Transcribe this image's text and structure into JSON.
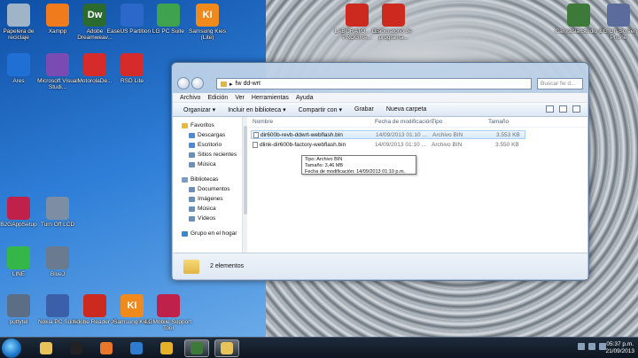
{
  "desktop_icons": [
    {
      "label": "Papelera de reciclaje",
      "icon": "recycle-bin-icon",
      "color": "#9fb4c7"
    },
    {
      "label": "Xampp",
      "icon": "xampp-icon",
      "color": "#f07b1c"
    },
    {
      "label": "Adobe Dreamweav...",
      "icon": "dreamweaver-icon",
      "color": "#2c6b2f",
      "glyph": "Dw"
    },
    {
      "label": "EaseUS Partition ...",
      "icon": "easeus-icon",
      "color": "#2c68c9"
    },
    {
      "label": "LG PC Suite",
      "icon": "lg-pc-suite-icon",
      "color": "#3fa34d"
    },
    {
      "label": "Samsung Kies (Lite)",
      "icon": "samsung-kies-icon",
      "color": "#f08a1c",
      "glyph": "KI"
    },
    {
      "label": "Ares",
      "icon": "ares-icon",
      "color": "#1f6fd4"
    },
    {
      "label": "Microsoft Visual Studi...",
      "icon": "visual-studio-icon",
      "color": "#7a4bb3"
    },
    {
      "label": "MotorolaDe...",
      "icon": "motorola-icon",
      "color": "#d62b2b"
    },
    {
      "label": "RSD Lite",
      "icon": "rsd-lite-icon",
      "color": "#d62b2b"
    },
    {
      "label": "B2GAppSetup",
      "icon": "lg-b2g-icon",
      "color": "#c0214a"
    },
    {
      "label": "Turn Off LCD",
      "icon": "laptop-icon",
      "color": "#7c8ea3"
    },
    {
      "label": "LINE",
      "icon": "line-icon",
      "color": "#35b648"
    },
    {
      "label": "BlueJ",
      "icon": "bluej-icon",
      "color": "#6a7b8f"
    },
    {
      "label": "puttytel",
      "icon": "puttytel-icon",
      "color": "#5c6e86"
    },
    {
      "label": "Nokia PC Suite",
      "icon": "nokia-pc-suite-icon",
      "color": "#3b5fa8"
    },
    {
      "label": "Adobe Reader XI",
      "icon": "adobe-reader-icon",
      "color": "#cc2a1e"
    },
    {
      "label": "Samsung Kies",
      "icon": "samsung-kies-icon",
      "color": "#f08a1c",
      "glyph": "KI"
    },
    {
      "label": "LGMobile Support Tool",
      "icon": "lg-support-icon",
      "color": "#c0214a"
    },
    {
      "label": "LABORATO... DE PROGRA...",
      "icon": "pdf-icon",
      "color": "#cc2a1e"
    },
    {
      "label": "Laboratorio de programa...",
      "icon": "pdf-icon",
      "color": "#cc2a1e"
    },
    {
      "label": "Camtasia Studio 8",
      "icon": "camtasia-icon",
      "color": "#3d7a3a"
    },
    {
      "label": "LG On-Screen Phone",
      "icon": "lg-phone-icon",
      "color": "#5a6b9c"
    }
  ],
  "window": {
    "path": "fw dd-wrt",
    "search_placeholder": "Buscar fw d...",
    "menu": [
      "Archivo",
      "Edición",
      "Ver",
      "Herramientas",
      "Ayuda"
    ],
    "toolbar": [
      "Organizar ▾",
      "Incluir en biblioteca ▾",
      "Compartir con ▾",
      "Grabar",
      "Nueva carpeta"
    ],
    "nav": [
      {
        "label": "Favoritos",
        "type": "header",
        "icon": "star-icon",
        "color": "#e9b73a"
      },
      {
        "label": "Descargas",
        "type": "item",
        "icon": "downloads-icon",
        "color": "#4a8ad6"
      },
      {
        "label": "Escritorio",
        "type": "item",
        "icon": "desktop-icon",
        "color": "#4a8ad6"
      },
      {
        "label": "Sitios recientes",
        "type": "item",
        "icon": "recent-places-icon",
        "color": "#6a8fb8"
      },
      {
        "label": "Música",
        "type": "item",
        "icon": "music-icon",
        "color": "#6a8fb8"
      },
      {
        "label": "",
        "type": "gap"
      },
      {
        "label": "Bibliotecas",
        "type": "header",
        "icon": "libraries-icon",
        "color": "#7a9dc8"
      },
      {
        "label": "Documentos",
        "type": "item",
        "icon": "documents-icon",
        "color": "#6a8fb8"
      },
      {
        "label": "Imágenes",
        "type": "item",
        "icon": "pictures-icon",
        "color": "#6a8fb8"
      },
      {
        "label": "Música",
        "type": "item",
        "icon": "music-icon",
        "color": "#6a8fb8"
      },
      {
        "label": "Vídeos",
        "type": "item",
        "icon": "videos-icon",
        "color": "#6a8fb8"
      },
      {
        "label": "",
        "type": "gap"
      },
      {
        "label": "Grupo en el hogar",
        "type": "header",
        "icon": "homegroup-icon",
        "color": "#3a8ad0"
      }
    ],
    "columns": [
      "Nombre",
      "Fecha de modificación",
      "Tipo",
      "Tamaño"
    ],
    "files": [
      {
        "name": "dir600b-revb-ddwrt-webflash.bin",
        "date": "14/09/2013 01:10 ...",
        "type": "Archivo BIN",
        "size": "3.553 KB"
      },
      {
        "name": "dlink-dir600b-factory-webflash.bin",
        "date": "14/09/2013 01:10 ...",
        "type": "Archivo BIN",
        "size": "3.550 KB"
      }
    ],
    "tooltip": [
      "Tipo: Archivo BIN",
      "Tamaño: 3,46 MB",
      "Fecha de modificación: 14/09/2013 01:10 p.m."
    ],
    "status": "2 elementos"
  },
  "taskbar": {
    "items": [
      {
        "name": "explorer-taskbar-icon",
        "color": "#e7c35a",
        "active": false
      },
      {
        "name": "cmd-taskbar-icon",
        "color": "#222",
        "active": false
      },
      {
        "name": "firefox-taskbar-icon",
        "color": "#e8762b",
        "active": false
      },
      {
        "name": "internet-explorer-taskbar-icon",
        "color": "#2e7bd0",
        "active": false
      },
      {
        "name": "chrome-taskbar-icon",
        "color": "#e5b02a",
        "active": false
      },
      {
        "name": "camtasia-taskbar-icon",
        "color": "#3d7a3a",
        "active": true
      },
      {
        "name": "explorer-window-taskbar-icon",
        "color": "#e7c35a",
        "active": true
      }
    ],
    "time": "05:37 p.m.",
    "date": "21/09/2013"
  }
}
